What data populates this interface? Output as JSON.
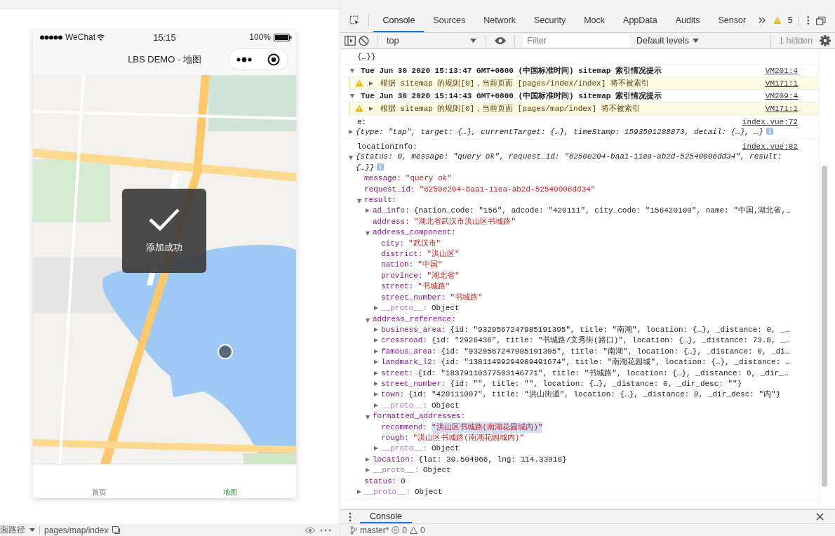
{
  "simulator": {
    "status_bar": {
      "carrier": "WeChat",
      "time": "15:15",
      "battery": "100%"
    },
    "nav": {
      "title": "LBS DEMO - 地图"
    },
    "toast": {
      "text": "添加成功"
    },
    "tab_bar": [
      {
        "label": "首页",
        "selected": false
      },
      {
        "label": "地图",
        "selected": true
      }
    ],
    "path_bar": {
      "label": "面路径",
      "path": "pages/map/index"
    }
  },
  "devtools": {
    "tabs": [
      {
        "label": "Console",
        "selected": true
      },
      {
        "label": "Sources",
        "selected": false
      },
      {
        "label": "Network",
        "selected": false
      },
      {
        "label": "Security",
        "selected": false
      },
      {
        "label": "Mock",
        "selected": false
      },
      {
        "label": "AppData",
        "selected": false
      },
      {
        "label": "Audits",
        "selected": false
      },
      {
        "label": "Sensor",
        "selected": false
      }
    ],
    "warning_count": "5",
    "toolbar": {
      "context": "top",
      "filter_placeholder": "Filter",
      "levels": "Default levels",
      "hidden": "1 hidden"
    },
    "console": [
      {
        "kind": "continuation",
        "text": "{…}}"
      },
      {
        "kind": "group",
        "expanded": true,
        "text": "Tue Jun 30 2020 15:13:47 GMT+0800 (中国标准时间) sitemap 索引情况提示",
        "source": "VM201:4"
      },
      {
        "kind": "warning",
        "expanded": false,
        "text": "根据 sitemap 的规则[0]，当前页面 [pages/index/index] 将不被索引",
        "source": "VM171:1"
      },
      {
        "kind": "group",
        "expanded": true,
        "text": "Tue Jun 30 2020 15:14:43 GMT+0800 (中国标准时间) sitemap 索引情况提示",
        "source": "VM209:4"
      },
      {
        "kind": "warning",
        "expanded": false,
        "text": "根据 sitemap 的规则[0]，当前页面 [pages/map/index] 将不被索引",
        "source": "VM171:1"
      },
      {
        "kind": "log",
        "label": "e:",
        "source": "index.vue:72",
        "tree": [
          {
            "kind": "preview",
            "value": "{type: \"tap\", target: {…}, currentTarget: {…}, timeStamp: 1593501288873, detail: {…}, …}",
            "expanded": false
          }
        ]
      },
      {
        "kind": "log",
        "label": "locationInfo:",
        "source": "index.vue:82",
        "tree": [
          {
            "kind": "preview",
            "value": "{status: 0, message: \"query ok\", request_id: \"6250e204-baa1-11ea-ab2d-52540006dd34\", result: {…}}",
            "expanded": true,
            "children": [
              {
                "kind": "string",
                "key": "message:",
                "value": "\"query ok\""
              },
              {
                "kind": "string",
                "key": "request_id:",
                "value": "\"6250e204-baa1-11ea-ab2d-52540006dd34\""
              },
              {
                "kind": "branch",
                "key": "result:",
                "expanded": true,
                "children": [
                  {
                    "kind": "object",
                    "key": "ad_info:",
                    "value": "{nation_code: \"156\", adcode: \"420111\", city_code: \"156420100\", name: \"中国,湖北省,…",
                    "expanded": false
                  },
                  {
                    "kind": "string",
                    "key": "address:",
                    "value": "\"湖北省武汉市洪山区书城路\""
                  },
                  {
                    "kind": "branch",
                    "key": "address_component:",
                    "expanded": true,
                    "children": [
                      {
                        "kind": "string",
                        "key": "city:",
                        "value": "\"武汉市\""
                      },
                      {
                        "kind": "string",
                        "key": "district:",
                        "value": "\"洪山区\""
                      },
                      {
                        "kind": "string",
                        "key": "nation:",
                        "value": "\"中国\""
                      },
                      {
                        "kind": "string",
                        "key": "province:",
                        "value": "\"湖北省\""
                      },
                      {
                        "kind": "string",
                        "key": "street:",
                        "value": "\"书城路\""
                      },
                      {
                        "kind": "string",
                        "key": "street_number:",
                        "value": "\"书城路\""
                      },
                      {
                        "kind": "internal",
                        "key": "__proto__:",
                        "value": "Object",
                        "expanded": false
                      }
                    ]
                  },
                  {
                    "kind": "branch",
                    "key": "address_reference:",
                    "expanded": true,
                    "children": [
                      {
                        "kind": "object",
                        "key": "business_area:",
                        "value": "{id: \"9329567247985191395\", title: \"南湖\", location: {…}, _distance: 0, _…",
                        "expanded": false
                      },
                      {
                        "kind": "object",
                        "key": "crossroad:",
                        "value": "{id: \"2926436\", title: \"书城路/文秀街(路口)\", location: {…}, _distance: 73.8, _…",
                        "expanded": false
                      },
                      {
                        "kind": "object",
                        "key": "famous_area:",
                        "value": "{id: \"9329567247985191395\", title: \"南湖\", location: {…}, _distance: 0, _di…",
                        "expanded": false
                      },
                      {
                        "kind": "object",
                        "key": "landmark_l2:",
                        "value": "{id: \"13811499294989491674\", title: \"南湖花园城\", location: {…}, _distance: …",
                        "expanded": false
                      },
                      {
                        "kind": "object",
                        "key": "street:",
                        "value": "{id: \"18379110377503146771\", title: \"书城路\", location: {…}, _distance: 0, _dir_…",
                        "expanded": false
                      },
                      {
                        "kind": "object",
                        "key": "street_number:",
                        "value": "{id: \"\", title: \"\", location: {…}, _distance: 0, _dir_desc: \"\"}",
                        "expanded": false
                      },
                      {
                        "kind": "object",
                        "key": "town:",
                        "value": "{id: \"420111007\", title: \"洪山街道\", location: {…}, _distance: 0, _dir_desc: \"内\"}",
                        "expanded": false
                      },
                      {
                        "kind": "internal",
                        "key": "__proto__:",
                        "value": "Object",
                        "expanded": false
                      }
                    ]
                  },
                  {
                    "kind": "branch",
                    "key": "formatted_addresses:",
                    "expanded": true,
                    "children": [
                      {
                        "kind": "string",
                        "key": "recommend:",
                        "value": "\"洪山区书城路(南湖花园城内)\"",
                        "highlighted": true
                      },
                      {
                        "kind": "string",
                        "key": "rough:",
                        "value": "\"洪山区书城路(南湖花园城内)\"",
                        "highlighted": false
                      },
                      {
                        "kind": "internal",
                        "key": "__proto__:",
                        "value": "Object",
                        "expanded": false,
                        "highlighted": false
                      }
                    ]
                  },
                  {
                    "kind": "object",
                    "key": "location:",
                    "value": "{lat: 30.504966, lng: 114.33918}",
                    "expanded": false
                  },
                  {
                    "kind": "internal",
                    "key": "__proto__:",
                    "value": "Object",
                    "expanded": false
                  }
                ]
              },
              {
                "kind": "number",
                "key": "status:",
                "value": "0"
              },
              {
                "kind": "internal",
                "key": "__proto__:",
                "value": "Object",
                "expanded": false
              }
            ]
          }
        ]
      }
    ],
    "drawer_tab": "Console",
    "status_bar": {
      "branch": "master*",
      "errors": "0",
      "warnings": "0"
    }
  }
}
